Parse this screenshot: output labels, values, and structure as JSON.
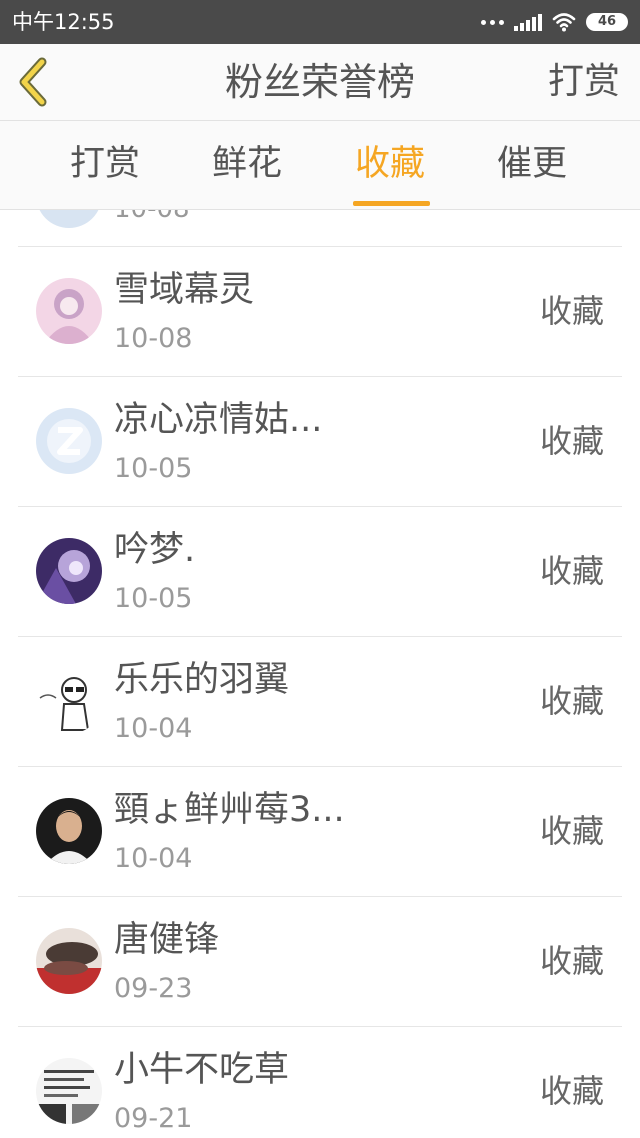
{
  "status_bar": {
    "time": "中午12:55",
    "battery": "46",
    "icons": [
      "dots-icon",
      "signal-icon",
      "wifi-icon",
      "battery-icon"
    ]
  },
  "header": {
    "title": "粉丝荣誉榜",
    "back_icon": "chevron-left-icon",
    "right_action": "打赏"
  },
  "tabs": [
    {
      "label": "打赏",
      "active": false
    },
    {
      "label": "鲜花",
      "active": false
    },
    {
      "label": "收藏",
      "active": true
    },
    {
      "label": "催更",
      "active": false
    }
  ],
  "list": {
    "partial_top_date": "10-08",
    "items": [
      {
        "name": "雪域幕灵",
        "date": "10-08",
        "action": "收藏"
      },
      {
        "name": "凉心凉情姑...",
        "date": "10-05",
        "action": "收藏"
      },
      {
        "name": "吟梦.",
        "date": "10-05",
        "action": "收藏"
      },
      {
        "name": "乐乐的羽翼",
        "date": "10-04",
        "action": "收藏"
      },
      {
        "name": "頸ょ鲜艸莓3...",
        "date": "10-04",
        "action": "收藏"
      },
      {
        "name": "唐健锋",
        "date": "09-23",
        "action": "收藏"
      },
      {
        "name": "小牛不吃草",
        "date": "09-21",
        "action": "收藏"
      }
    ]
  },
  "colors": {
    "accent": "#f5a623",
    "status_bar": "#4a4a4a",
    "text": "#555555",
    "muted": "#9a9a9a"
  }
}
